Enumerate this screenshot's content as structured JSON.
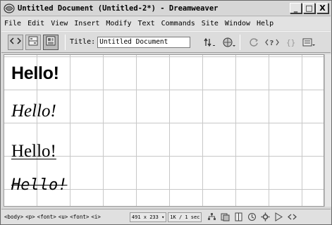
{
  "window": {
    "title": "Untitled Document (Untitled-2*) - Dreamweaver",
    "controls": {
      "minimize": "_",
      "maximize": "□",
      "close": "X"
    }
  },
  "menu": [
    "File",
    "Edit",
    "View",
    "Insert",
    "Modify",
    "Text",
    "Commands",
    "Site",
    "Window",
    "Help"
  ],
  "toolbar": {
    "title_label": "Title:",
    "title_value": "Untitled Document",
    "icons": [
      "code-view-icon",
      "split-view-icon",
      "design-view-icon",
      "file-management-icon",
      "preview-browser-icon",
      "refresh-icon",
      "code-navigation-icon",
      "braces-icon",
      "view-options-icon"
    ]
  },
  "document": {
    "lines": [
      "Hello!",
      "Hello!",
      "Hello!",
      "Hello!"
    ]
  },
  "statusbar": {
    "tags": [
      "<body>",
      "<p>",
      "<font>",
      "<u>",
      "<font>",
      "<i>"
    ],
    "window_size": "491 x 233",
    "download_stats": "1K / 1 sec",
    "icons": [
      "site-icon",
      "assets-icon",
      "html-styles-icon",
      "behaviors-icon",
      "css-icon",
      "timeline-icon",
      "source-icon"
    ]
  }
}
